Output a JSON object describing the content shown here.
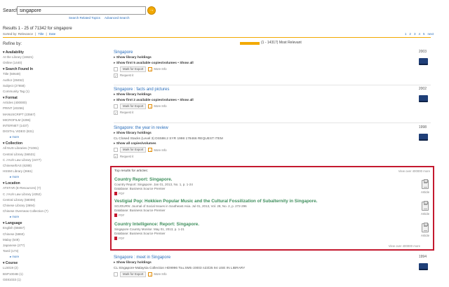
{
  "search": {
    "label": "Search:",
    "value": "singapore",
    "go_symbol": "→",
    "links": [
      "Search Related Topics",
      "Advanced Search"
    ]
  },
  "results_summary": "Results 1 - 25 of 71342 for singapore",
  "sort": {
    "items": [
      "Sorted by: Relevance",
      "|",
      "Title",
      "|",
      "Date"
    ]
  },
  "pager": {
    "pages": [
      "1",
      "2",
      "3",
      "4",
      "5",
      "next"
    ]
  },
  "refine_label": "Refine by:",
  "relevance_label": "(1 - 14317) Most Relevant",
  "facets": [
    {
      "head": "Availability",
      "items": [
        "At the Library (16621)",
        "Online (1440)"
      ],
      "more": ""
    },
    {
      "head": "Search Found In",
      "items": [
        "Title (50648)",
        "Author (28452)",
        "Subject (27658)",
        "Community Tag (1)"
      ],
      "more": ""
    },
    {
      "head": "Format",
      "items": [
        "Articles (400000)",
        "PRINT (40256)",
        "MANUSCRIPT (23567)",
        "MICROFILM (2296)",
        "INTERNET (1437)",
        "DIGITAL VIDEO (831)"
      ],
      "more": "more"
    },
    {
      "head": "Collection",
      "items": [
        "All NUS Libraries (71081)",
        "Central Library (56531)",
        "C J Koh Law Library (4477)",
        "Chinese/EAS (6288)",
        "HSSM Library (2661)"
      ],
      "more": "more"
    },
    {
      "head": "Location",
      "items": [
        "ATSTAR (E-Resources) (7)",
        "C J Koh Law Library (4352)",
        "Central Library (58009)",
        "Chinese Library (3694)",
        "Chinese Overseas Collection (7)"
      ],
      "more": "more"
    },
    {
      "head": "Language",
      "items": [
        "English (65657)",
        "Chinese (5860)",
        "Malay (549)",
        "Japanese (277)",
        "Tamil (173)"
      ],
      "more": "more"
    },
    {
      "head": "Course",
      "items": [
        "LL5019 (2)",
        "BSP1004B (1)",
        "GE81033 (1)"
      ],
      "more": ""
    }
  ],
  "results": [
    {
      "title": "Singapore",
      "year": "2003",
      "lines": [
        "Show library holdings",
        "Show first 5 available copies/volumes • Show all"
      ],
      "mark": "Mark for Export",
      "more_info": "More Info",
      "request": "Request it"
    },
    {
      "title": "Singapore : facts and pictures",
      "year": "2002",
      "lines": [
        "Show library holdings",
        "Show first 2 available copies/volumes • Show all"
      ],
      "mark": "Mark for Export",
      "more_info": "More Info",
      "request": "Request it"
    },
    {
      "title": "Singapore: the year in review",
      "year": "1998",
      "lines": [
        "Show library holdings",
        "CL Closed Stacks (Level 3)  DS598.2 SYR 1998    178466  REQUEST ITEM",
        "Show all copies/volumes"
      ],
      "mark": "Mark for Export",
      "more_info": "More Info",
      "request": "Request it"
    },
    {
      "title": "Singapore : meet in Singapore",
      "year": "1994",
      "lines": [
        "Show library holdings",
        "CL Singapore-Malaysia Collection  HD9996 Tou.SM5 c0003 n23/25 94     USE IN LIBRARY"
      ],
      "mark": "Mark for Export",
      "more_info": "More Info",
      "request": ""
    }
  ],
  "articles": {
    "head": "Top results for articles:",
    "view_all": "View over 400000 more",
    "items": [
      {
        "title": "Country Report: Singapore.",
        "lines": [
          "Country Report: Singapore. Jan 01, 2013, No. 1, p. 1-24",
          "Database: Business Source Premier"
        ],
        "pdf": "PDF",
        "label": "Article"
      },
      {
        "title": "Vestigial Pop: Hokkien Popular Music and the Cultural Fossilization of Subalternity in Singapore.",
        "lines": [
          "SOJOURN: Journal of Social Issues in Southeast Asia. Jul 01, 2013, Vol. 28, No. 2, p. 272-296",
          "Database: Business Source Premier"
        ],
        "pdf": "PDF",
        "label": "Article"
      },
      {
        "title": "Country Intelligence: Report: Singapore.",
        "lines": [
          "Singapore Country Monitor. May 01, 2013, p. 1-21",
          "Database: Business Source Premier"
        ],
        "pdf": "PDF",
        "label": "Article"
      }
    ]
  }
}
